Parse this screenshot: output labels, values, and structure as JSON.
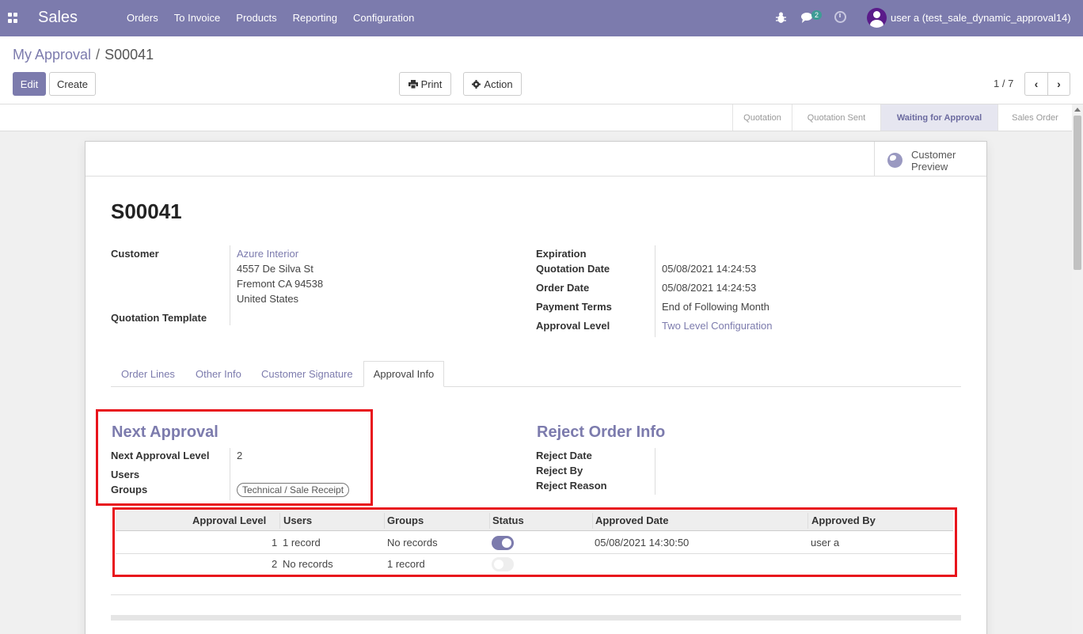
{
  "navbar": {
    "brand": "Sales",
    "menu": [
      "Orders",
      "To Invoice",
      "Products",
      "Reporting",
      "Configuration"
    ],
    "chat_count": "2",
    "user": "user a (test_sale_dynamic_approval14)"
  },
  "breadcrumb": {
    "parent": "My Approval",
    "separator": "/",
    "current": "S00041"
  },
  "buttons": {
    "edit": "Edit",
    "create": "Create",
    "print": "Print",
    "action": "Action"
  },
  "pager": "1 / 7",
  "statusbar": [
    "Quotation",
    "Quotation Sent",
    "Waiting for Approval",
    "Sales Order"
  ],
  "status_active": "Waiting for Approval",
  "customer_preview": [
    "Customer",
    "Preview"
  ],
  "record": {
    "name": "S00041",
    "customer_label": "Customer",
    "customer_name": "Azure Interior",
    "address": [
      "4557 De Silva St",
      "Fremont CA 94538",
      "United States"
    ],
    "template_label": "Quotation Template",
    "expiration_label": "Expiration",
    "quotation_date_label": "Quotation Date",
    "quotation_date": "05/08/2021 14:24:53",
    "order_date_label": "Order Date",
    "order_date": "05/08/2021 14:24:53",
    "payment_terms_label": "Payment Terms",
    "payment_terms": "End of Following Month",
    "approval_level_label": "Approval Level",
    "approval_level": "Two Level Configuration"
  },
  "tabs": [
    "Order Lines",
    "Other Info",
    "Customer Signature",
    "Approval Info"
  ],
  "next_approval": {
    "title": "Next Approval",
    "level_label": "Next Approval Level",
    "level": "2",
    "users_label": "Users",
    "groups_label": "Groups",
    "group_tag": "Technical / Sale Receipt"
  },
  "reject_info": {
    "title": "Reject Order Info",
    "date_label": "Reject Date",
    "by_label": "Reject By",
    "reason_label": "Reject Reason"
  },
  "approval_table": {
    "headers": [
      "Approval Level",
      "Users",
      "Groups",
      "Status",
      "Approved Date",
      "Approved By"
    ],
    "rows": [
      {
        "level": "1",
        "users": "1 record",
        "groups": "No records",
        "status": true,
        "date": "05/08/2021 14:30:50",
        "by": "user a"
      },
      {
        "level": "2",
        "users": "No records",
        "groups": "1 record",
        "status": false,
        "date": "",
        "by": ""
      }
    ]
  },
  "colors": {
    "brand": "#7c7bad",
    "highlight": "#e8141c"
  }
}
